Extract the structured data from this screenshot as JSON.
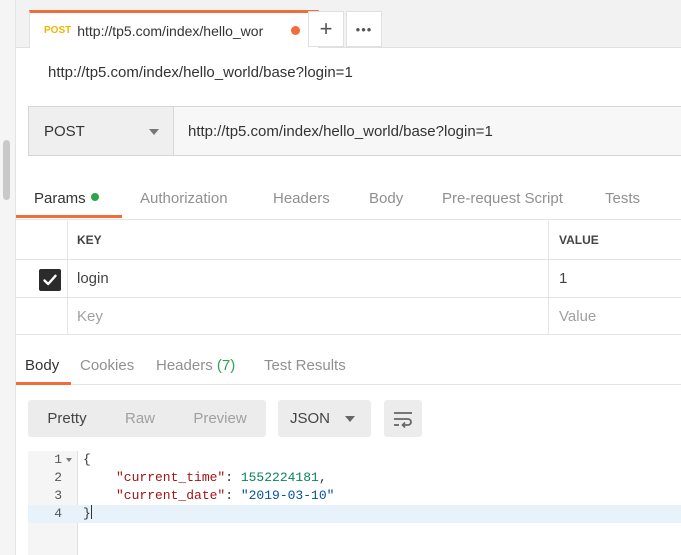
{
  "tab": {
    "method": "POST",
    "title": "http://tp5.com/index/hello_wor",
    "add_icon": "+",
    "more_icon": "•••"
  },
  "request": {
    "title": "http://tp5.com/index/hello_world/base?login=1",
    "method": "POST",
    "url": "http://tp5.com/index/hello_world/base?login=1"
  },
  "request_tabs": [
    "Params",
    "Authorization",
    "Headers",
    "Body",
    "Pre-request Script",
    "Tests"
  ],
  "params": {
    "headers": {
      "key": "KEY",
      "value": "VALUE"
    },
    "rows": [
      {
        "key": "login",
        "value": "1",
        "checked": true
      }
    ],
    "placeholder": {
      "key": "Key",
      "value": "Value"
    }
  },
  "response_tabs": {
    "body": "Body",
    "cookies": "Cookies",
    "headers": "Headers",
    "headers_count": "(7)",
    "test_results": "Test Results"
  },
  "response_toolbar": {
    "modes": [
      "Pretty",
      "Raw",
      "Preview"
    ],
    "active_mode": "Pretty",
    "format": "JSON"
  },
  "code": {
    "line_numbers": [
      "1",
      "2",
      "3",
      "4"
    ],
    "open_brace": "{",
    "close_brace": "}",
    "key1": "\"current_time\"",
    "val1": "1552224181",
    "key2": "\"current_date\"",
    "val2": "\"2019-03-10\"",
    "colon": ": ",
    "comma": ","
  },
  "colors": {
    "accent": "#f26b3a",
    "method_badge": "#f5b400",
    "status_green": "#2ea44f"
  }
}
